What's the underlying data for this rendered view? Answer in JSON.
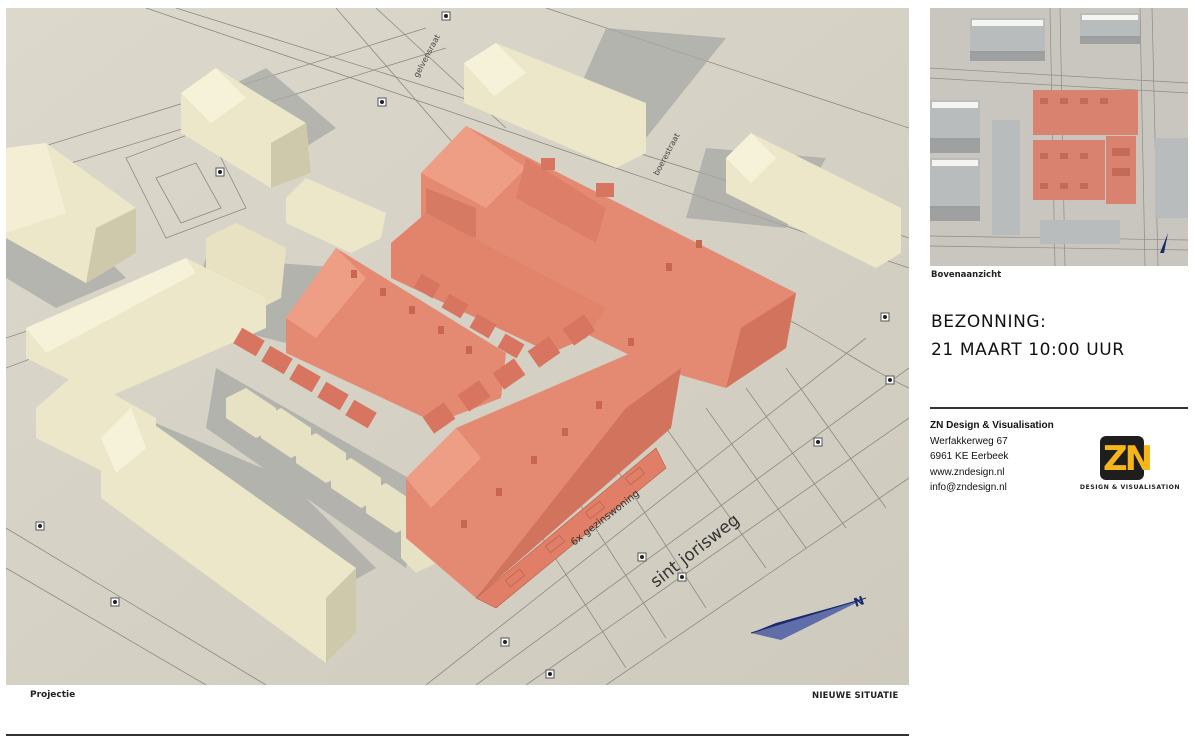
{
  "main_view": {
    "caption_left": "Projectie",
    "caption_right": "NIEUWE SITUATIE",
    "street_labels": [
      "sint jorisweg",
      "6x gezinswoning",
      "boerestraat",
      "gelvensraat"
    ],
    "north_label": "N"
  },
  "top_view": {
    "caption": "Bovenaanzicht"
  },
  "study": {
    "title_line1": "BEZONNING:",
    "title_line2": "21 MAART 10:00 UUR"
  },
  "company": {
    "name": "ZN Design & Visualisation",
    "address": "Werfakkerweg 67",
    "postal": "6961 KE Eerbeek",
    "web": "www.zndesign.nl",
    "email": "info@zndesign.nl",
    "logo_text": "ZN",
    "logo_sub": "DESIGN & VISUALISATION"
  },
  "colors": {
    "new_building": "#e58a72",
    "existing_building": "#ece7c8",
    "ground": "#d8d3c7",
    "logo_accent": "#f5b51b"
  }
}
